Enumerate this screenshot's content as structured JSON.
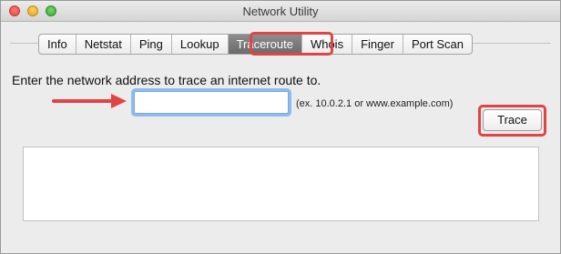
{
  "window": {
    "title": "Network Utility"
  },
  "tabs": [
    {
      "label": "Info"
    },
    {
      "label": "Netstat"
    },
    {
      "label": "Ping"
    },
    {
      "label": "Lookup"
    },
    {
      "label": "Traceroute",
      "selected": true
    },
    {
      "label": "Whois"
    },
    {
      "label": "Finger"
    },
    {
      "label": "Port Scan"
    }
  ],
  "traceroute": {
    "prompt": "Enter the network address to trace an internet route to.",
    "address_value": "",
    "example": "(ex. 10.0.2.1 or www.example.com)",
    "trace_button": "Trace",
    "output_text": ""
  },
  "annotation": {
    "color": "#e04444"
  }
}
